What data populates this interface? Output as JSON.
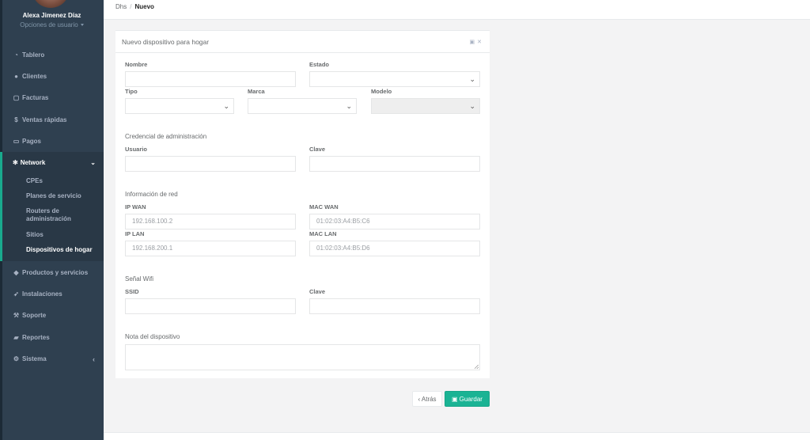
{
  "sidebar": {
    "profile": {
      "name": "Alexa Jimenez Díaz",
      "options_label": "Opciones de usuario"
    },
    "items": [
      {
        "label": "Tablero",
        "icon": "dashboard-icon"
      },
      {
        "label": "Clientes",
        "icon": "users-icon"
      },
      {
        "label": "Facturas",
        "icon": "file-icon"
      },
      {
        "label": "Ventas rápidas",
        "icon": "dollar-icon"
      },
      {
        "label": "Pagos",
        "icon": "money-icon"
      },
      {
        "label": "Productos y servicios",
        "icon": "tags-icon"
      },
      {
        "label": "Instalaciones",
        "icon": "rocket-icon"
      },
      {
        "label": "Soporte",
        "icon": "wrench-icon"
      },
      {
        "label": "Reportes",
        "icon": "book-icon"
      },
      {
        "label": "Sistema",
        "icon": "cogs-icon"
      }
    ],
    "network": {
      "label": "Network",
      "icon": "snowflake-icon",
      "children": [
        "CPEs",
        "Planes de servicio",
        "Routers de administración",
        "Sitios",
        "Dispositivos de hogar"
      ],
      "active_child": "Dispositivos de hogar"
    }
  },
  "breadcrumb": {
    "parent": "Dhs",
    "current": "Nuevo"
  },
  "panel": {
    "title": "Nuevo dispositivo para hogar",
    "labels": {
      "nombre": "Nombre",
      "estado": "Estado",
      "tipo": "Tipo",
      "marca": "Marca",
      "modelo": "Modelo",
      "usuario": "Usuario",
      "clave": "Clave",
      "ip_wan": "IP WAN",
      "mac_wan": "MAC WAN",
      "ip_lan": "IP LAN",
      "mac_lan": "MAC LAN",
      "ssid": "SSID",
      "clave_wifi": "Clave",
      "nota": "Nota del dispositivo"
    },
    "sections": {
      "credencial": "Credencial de administración",
      "red": "Información de red",
      "wifi": "Señal Wifi"
    },
    "placeholders": {
      "ip_wan": "192.168.100.2",
      "mac_wan": "01:02:03:A4:B5:C6",
      "ip_lan": "192.168.200.1",
      "mac_lan": "01:02:03:A4:B5:D6"
    }
  },
  "buttons": {
    "back": "‹ Atrás",
    "save": "Guardar"
  },
  "colors": {
    "sidebar": "#2f4050",
    "accent": "#1ab394",
    "active_border": "#19aa8d"
  }
}
